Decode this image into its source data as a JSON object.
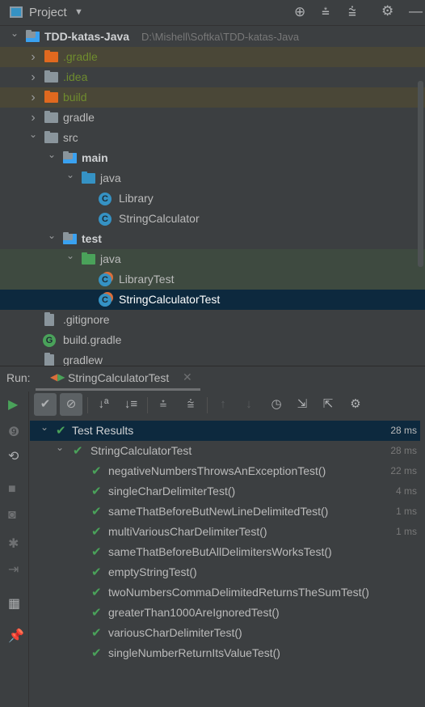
{
  "header": {
    "title": "Project",
    "icons": [
      "locate-icon",
      "expand-all-icon",
      "collapse-all-icon",
      "gear-icon",
      "minimize-icon"
    ]
  },
  "tree": [
    {
      "label": "TDD-katas-Java",
      "path": "D:\\Mishell\\Softka\\TDD-katas-Java",
      "level": 0,
      "open": true,
      "kind": "module",
      "bold": true
    },
    {
      "label": ".gradle",
      "level": 1,
      "open": false,
      "kind": "folder-orange",
      "color": "#6f8c2e",
      "bg": "#4a4737"
    },
    {
      "label": ".idea",
      "level": 1,
      "open": false,
      "kind": "folder",
      "color": "#6f8c2e"
    },
    {
      "label": "build",
      "level": 1,
      "open": false,
      "kind": "folder-orange",
      "color": "#6f8c2e",
      "bg": "#4a4737"
    },
    {
      "label": "gradle",
      "level": 1,
      "open": false,
      "kind": "folder"
    },
    {
      "label": "src",
      "level": 1,
      "open": true,
      "kind": "folder"
    },
    {
      "label": "main",
      "level": 2,
      "open": true,
      "kind": "module",
      "bold": true
    },
    {
      "label": "java",
      "level": 3,
      "open": true,
      "kind": "folder-blue"
    },
    {
      "label": "Library",
      "level": 4,
      "kind": "class"
    },
    {
      "label": "StringCalculator",
      "level": 4,
      "kind": "class"
    },
    {
      "label": "test",
      "level": 2,
      "open": true,
      "kind": "module",
      "bold": true
    },
    {
      "label": "java",
      "level": 3,
      "open": true,
      "kind": "folder-green",
      "bg": "#3e4a40"
    },
    {
      "label": "LibraryTest",
      "level": 4,
      "kind": "class",
      "bg": "#3e4a40"
    },
    {
      "label": "StringCalculatorTest",
      "level": 4,
      "kind": "class",
      "bg": "#0d293e",
      "color": "#ffffff"
    },
    {
      "label": ".gitignore",
      "level": 1,
      "kind": "file"
    },
    {
      "label": "build.gradle",
      "level": 1,
      "kind": "gradle"
    },
    {
      "label": "gradlew",
      "level": 1,
      "kind": "file"
    }
  ],
  "run": {
    "label": "Run:",
    "tab": "StringCalculatorTest"
  },
  "results": [
    {
      "label": "Test Results",
      "level": 0,
      "ms": "28 ms",
      "selected": true
    },
    {
      "label": "StringCalculatorTest",
      "level": 1,
      "ms": "28 ms"
    },
    {
      "label": "negativeNumbersThrowsAnExceptionTest()",
      "level": 2,
      "ms": "22 ms"
    },
    {
      "label": "singleCharDelimiterTest()",
      "level": 2,
      "ms": "4 ms"
    },
    {
      "label": "sameThatBeforeButNewLineDelimitedTest()",
      "level": 2,
      "ms": "1 ms"
    },
    {
      "label": "multiVariousCharDelimiterTest()",
      "level": 2,
      "ms": "1 ms"
    },
    {
      "label": "sameThatBeforeButAllDelimitersWorksTest()",
      "level": 2,
      "ms": ""
    },
    {
      "label": "emptyStringTest()",
      "level": 2,
      "ms": ""
    },
    {
      "label": "twoNumbersCommaDelimitedReturnsTheSumTest()",
      "level": 2,
      "ms": ""
    },
    {
      "label": "greaterThan1000AreIgnoredTest()",
      "level": 2,
      "ms": ""
    },
    {
      "label": "variousCharDelimiterTest()",
      "level": 2,
      "ms": ""
    },
    {
      "label": "singleNumberReturnItsValueTest()",
      "level": 2,
      "ms": ""
    }
  ],
  "colors": {
    "pass": "#4aa25a",
    "selected": "#0d293e"
  }
}
